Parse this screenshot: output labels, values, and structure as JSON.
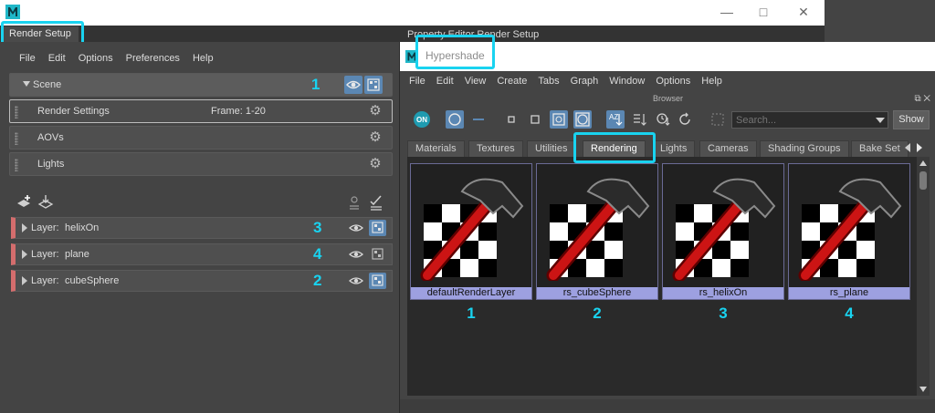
{
  "render_setup": {
    "tab_label": "Render Setup",
    "property_editor_tabs": "Property Editor   Render Setup",
    "menu": [
      "File",
      "Edit",
      "Options",
      "Preferences",
      "Help"
    ],
    "scene": {
      "label": "Scene",
      "badge": "1",
      "collections": [
        {
          "label": "Render Settings",
          "frame": "Frame: 1-20"
        },
        {
          "label": "AOVs"
        },
        {
          "label": "Lights"
        }
      ]
    },
    "layers": [
      {
        "prefix": "Layer:",
        "name": "helixOn",
        "badge": "3",
        "renderable": true
      },
      {
        "prefix": "Layer:",
        "name": "plane",
        "badge": "4",
        "renderable": false
      },
      {
        "prefix": "Layer:",
        "name": "cubeSphere",
        "badge": "2",
        "renderable": true
      }
    ]
  },
  "hypershade": {
    "title": "Hypershade",
    "menu": [
      "File",
      "Edit",
      "View",
      "Create",
      "Tabs",
      "Graph",
      "Window",
      "Options",
      "Help"
    ],
    "panel_title": "Browser",
    "on_label": "ON",
    "sort_label": "AZ",
    "search_placeholder": "Search...",
    "show_label": "Show",
    "tabs": [
      "Materials",
      "Textures",
      "Utilities",
      "Rendering",
      "Lights",
      "Cameras",
      "Shading Groups",
      "Bake Set"
    ],
    "active_tab": "Rendering",
    "swatches": [
      {
        "label": "defaultRenderLayer",
        "number": "1"
      },
      {
        "label": "rs_cubeSphere",
        "number": "2"
      },
      {
        "label": "rs_helixOn",
        "number": "3"
      },
      {
        "label": "rs_plane",
        "number": "4"
      }
    ]
  },
  "colors": {
    "highlight": "#19d3f0",
    "panel_bg": "#444444",
    "button_blue": "#5b87b3",
    "layer_accent": "#d46d6d",
    "swatch_label_bg": "#9da0e0"
  }
}
